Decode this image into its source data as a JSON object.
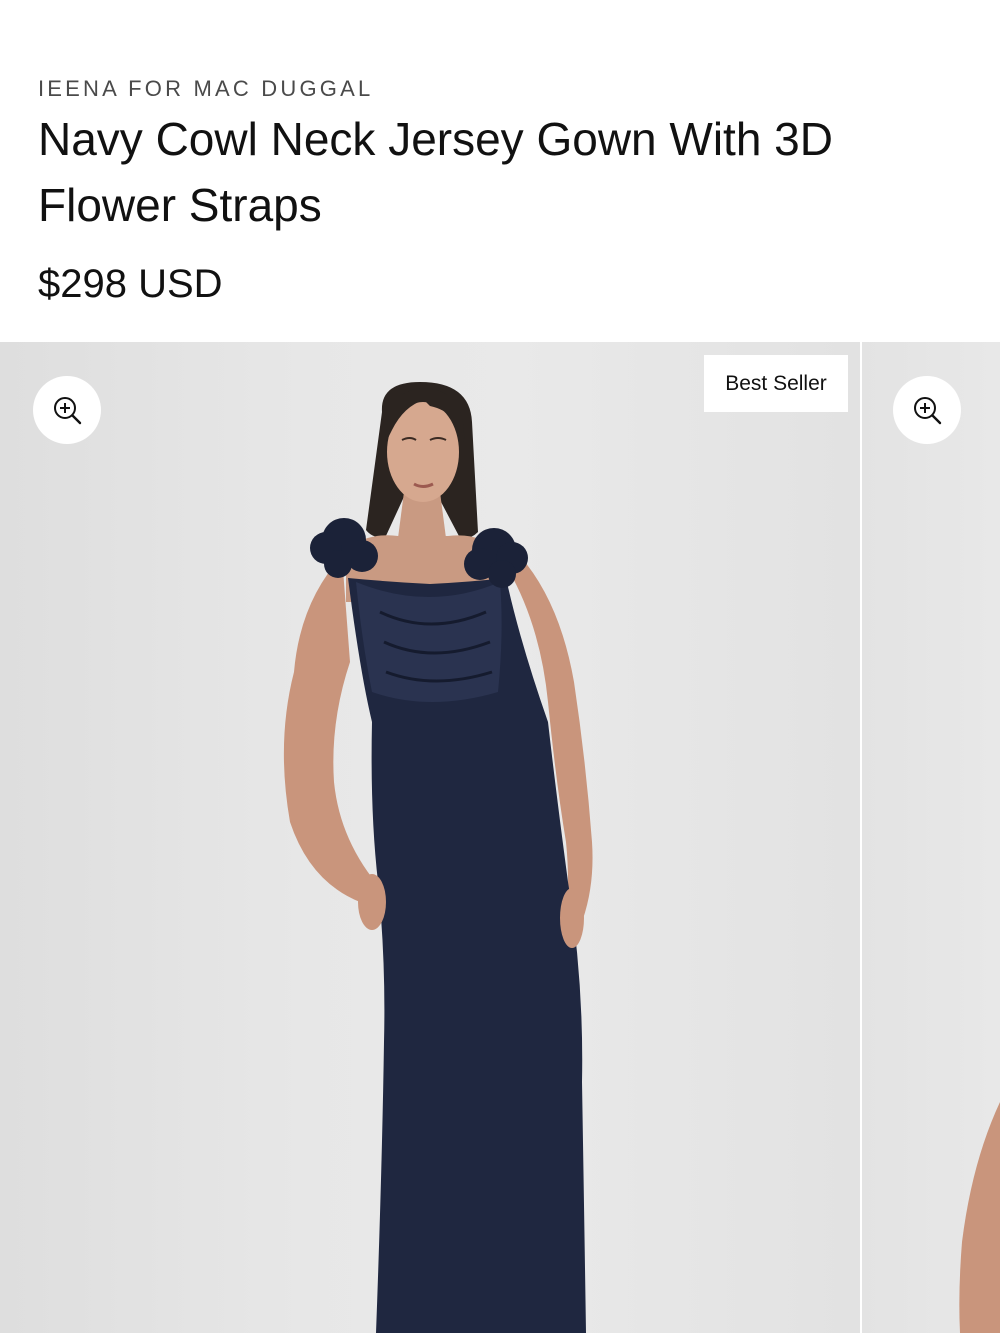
{
  "product": {
    "brand": "IEENA FOR MAC DUGGAL",
    "title": "Navy Cowl Neck Jersey Gown With 3D Flower Straps",
    "price": "$298 USD"
  },
  "gallery": {
    "badge": "Best Seller",
    "zoom_icon": "zoom-in-icon",
    "main_image": "model-in-navy-gown-photo",
    "next_image": "next-product-photo-partial"
  },
  "colors": {
    "dress": "#1f2740",
    "background": "#e6e6e6",
    "text": "#111111"
  }
}
